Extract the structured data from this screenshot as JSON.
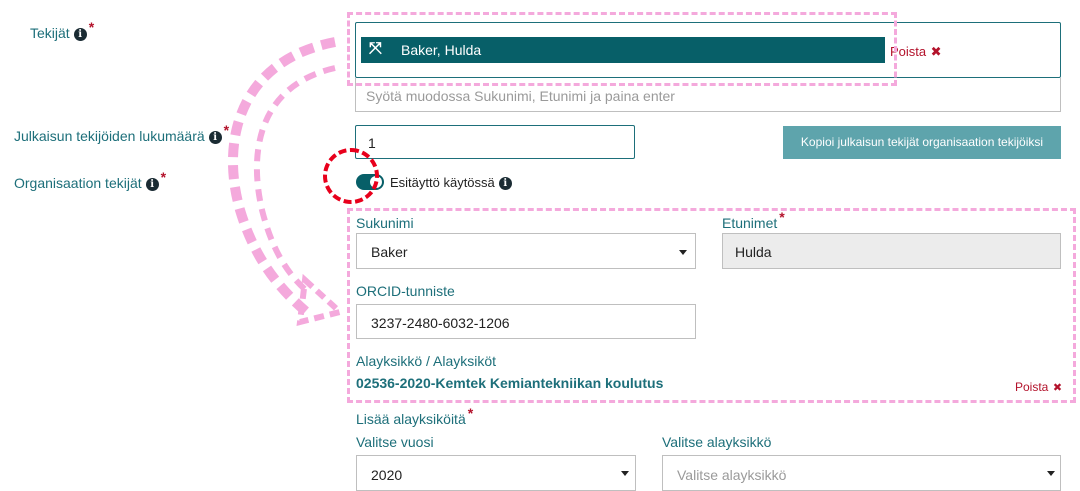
{
  "labels": {
    "authors": "Tekijät",
    "author_count": "Julkaisun tekijöiden lukumäärä",
    "org_authors": "Organisaation tekijät"
  },
  "author_chip": {
    "name": "Baker, Hulda",
    "remove": "Poista"
  },
  "author_input": {
    "placeholder": "Syötä muodossa Sukunimi, Etunimi ja paina enter"
  },
  "author_count": {
    "value": "1"
  },
  "copy_button": {
    "label": "Kopioi julkaisun tekijät organisaation tekijöiksi"
  },
  "prefill_toggle": {
    "label": "Esitäyttö käytössä",
    "state": "on"
  },
  "org_author": {
    "surname_label": "Sukunimi",
    "surname_value": "Baker",
    "firstnames_label": "Etunimet",
    "firstnames_value": "Hulda",
    "orcid_label": "ORCID-tunniste",
    "orcid_value": "3237-2480-6032-1206",
    "units_label": "Alayksikkö / Alayksiköt",
    "unit_value": "02536-2020-Kemtek Kemiantekniikan koulutus",
    "unit_remove": "Poista"
  },
  "add_units": {
    "label": "Lisää alayksiköitä",
    "year_label": "Valitse vuosi",
    "year_value": "2020",
    "unit_label": "Valitse alayksikkö",
    "unit_placeholder": "Valitse alayksikkö"
  },
  "colors": {
    "accent": "#1d6f7a",
    "chip_bg": "#075f68",
    "required": "#b3122b",
    "annotation_pink": "#f4a9dc",
    "annotation_red": "#e8001c",
    "button_bg": "#5ea4ac"
  }
}
